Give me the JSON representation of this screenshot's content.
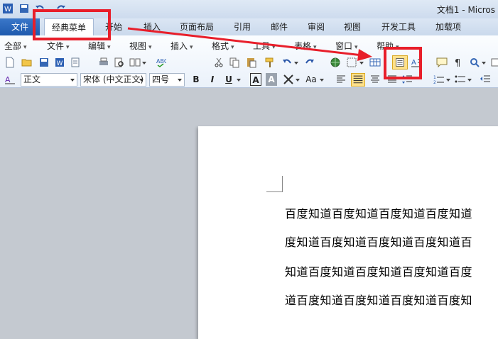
{
  "window": {
    "title": "文档1 - Micros",
    "quick_access": [
      "word-icon",
      "save-icon",
      "undo-icon",
      "redo-icon"
    ]
  },
  "tabs": [
    {
      "label": "文件"
    },
    {
      "label": "经典菜单"
    },
    {
      "label": "开始"
    },
    {
      "label": "插入"
    },
    {
      "label": "页面布局"
    },
    {
      "label": "引用"
    },
    {
      "label": "邮件"
    },
    {
      "label": "审阅"
    },
    {
      "label": "视图"
    },
    {
      "label": "开发工具"
    },
    {
      "label": "加载项"
    }
  ],
  "classic_menu": [
    {
      "label": "全部"
    },
    {
      "label": "文件"
    },
    {
      "label": "编辑"
    },
    {
      "label": "视图"
    },
    {
      "label": "插入"
    },
    {
      "label": "格式"
    },
    {
      "label": "工具"
    },
    {
      "label": "表格"
    },
    {
      "label": "窗口"
    },
    {
      "label": "帮助"
    }
  ],
  "format_bar": {
    "style_value": "正文",
    "font_value": "宋体 (中文正文)",
    "size_value": "四号",
    "bold": "B",
    "italic": "I",
    "underline": "U",
    "char_border": "A",
    "char_shading": "A",
    "change_case": "Aa"
  },
  "document": {
    "lines": [
      "百度知道百度知道百度知道百度知道",
      "度知道百度知道百度知道百度知道百",
      "知道百度知道百度知道百度知道百度",
      "道百度知道百度知道百度知道百度知"
    ]
  },
  "colors": {
    "accent": "#2b6bc0",
    "highlight": "#e81e2a",
    "active_button": "#ffe18a"
  }
}
